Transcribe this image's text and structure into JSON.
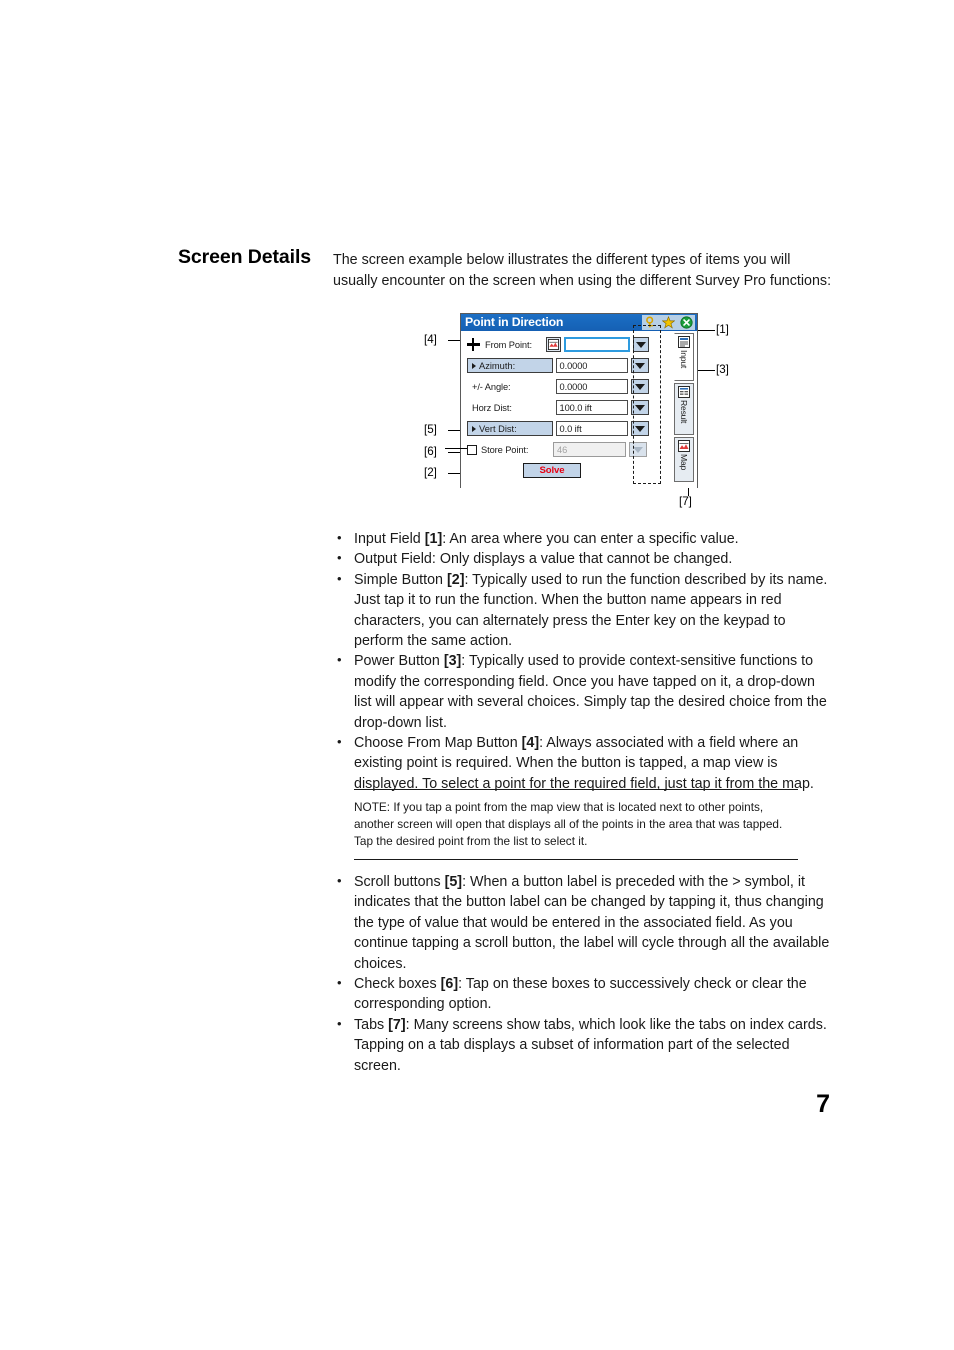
{
  "section": {
    "title": "Screen Details",
    "intro": "The screen example below illustrates the different types of items you will usually encounter on the screen when using the different Survey Pro functions:"
  },
  "figure": {
    "dialog": {
      "title": "Point in Direction",
      "title_icons": [
        {
          "name": "help-key-icon",
          "glyph": "key"
        },
        {
          "name": "favorites-star-icon",
          "glyph": "star"
        },
        {
          "name": "close-icon",
          "glyph": "close"
        }
      ],
      "rows": [
        {
          "label": "From Point:",
          "label_kind": "plain-with-plus",
          "has_map_button": true,
          "map_button_name": "choose-from-map-button",
          "value": "",
          "field_state": "focused",
          "power_button": "enabled"
        },
        {
          "label": "Azimuth:",
          "label_kind": "scroll-button",
          "has_map_button": false,
          "value": "0.0000",
          "field_state": "normal",
          "power_button": "enabled"
        },
        {
          "label": "+/- Angle:",
          "label_kind": "plain",
          "has_map_button": false,
          "value": "0.0000",
          "field_state": "normal",
          "power_button": "enabled"
        },
        {
          "label": "Horz Dist:",
          "label_kind": "plain",
          "has_map_button": false,
          "value": "100.0 ift",
          "field_state": "normal",
          "power_button": "enabled"
        },
        {
          "label": "Vert Dist:",
          "label_kind": "scroll-button",
          "has_map_button": false,
          "value": "0.0 ift",
          "field_state": "normal",
          "power_button": "enabled"
        },
        {
          "label": "Store Point:",
          "label_kind": "checkbox",
          "checked": false,
          "has_map_button": false,
          "value": "46",
          "field_state": "readonly",
          "power_button": "disabled"
        }
      ],
      "solve_button": "Solve",
      "tabs": [
        {
          "label": "Input",
          "icon": "input-tab-icon",
          "selected": true
        },
        {
          "label": "Result",
          "icon": "result-tab-icon",
          "selected": false
        },
        {
          "label": "Map",
          "icon": "map-tab-icon",
          "selected": false
        }
      ]
    },
    "callouts": {
      "c1": "[1]",
      "c2": "[2]",
      "c3": "[3]",
      "c4": "[4]",
      "c5": "[5]",
      "c6": "[6]",
      "c7": "[7]"
    }
  },
  "bullets": [
    {
      "term": "Input Field ",
      "ref": "[1]",
      "rest": ": An area where you can enter a specific value."
    },
    {
      "term": "Output Field",
      "ref": "",
      "rest": ": Only displays a value that cannot be changed."
    },
    {
      "term": "Simple Button ",
      "ref": "[2]",
      "rest": ": Typically used to run the function described by its name. Just tap it to run the function. When the button name appears in red characters, you can alternately press the Enter key on the keypad to perform the same action."
    },
    {
      "term": "Power Button ",
      "ref": "[3]",
      "rest": ": Typically used to provide context-sensitive functions to modify the corresponding field. Once you have tapped on it, a drop-down list will appear with several choices. Simply tap the desired choice from the drop-down list."
    },
    {
      "term": "Choose From Map Button ",
      "ref": "[4]",
      "rest": ": Always associated with a field where an existing point is required. When the button is tapped, a map view is displayed. To select a point for the required field, just tap it from the map."
    }
  ],
  "note": {
    "text": "NOTE: If you tap a point from the map view that is located next to other points, another screen will open that displays all of the points in the area that was tapped. Tap the desired point from the list to select it."
  },
  "bullets_after_note": [
    {
      "term": "Scroll buttons ",
      "ref": "[5]",
      "rest": ": When a button label is preceded with the > symbol, it indicates that the button label can be changed by tapping it, thus changing the type of value that would be entered in the associated field. As you continue tapping a scroll button, the label will cycle through all the available choices."
    },
    {
      "term": "Check boxes ",
      "ref": "[6]",
      "rest": ": Tap on these boxes to successively check or clear the corresponding option."
    },
    {
      "term": "Tabs ",
      "ref": "[7]",
      "rest": ": Many screens show tabs, which look like the tabs on index cards. Tapping on a tab displays a subset of information part of the selected screen."
    }
  ],
  "page_number": "7",
  "colors": {
    "titlebar": "#1868bd",
    "button_face": "#c2d4e8",
    "solve_text": "#e60012",
    "focus_border": "#2e9bdf",
    "close_green": "#1a9e3c"
  }
}
